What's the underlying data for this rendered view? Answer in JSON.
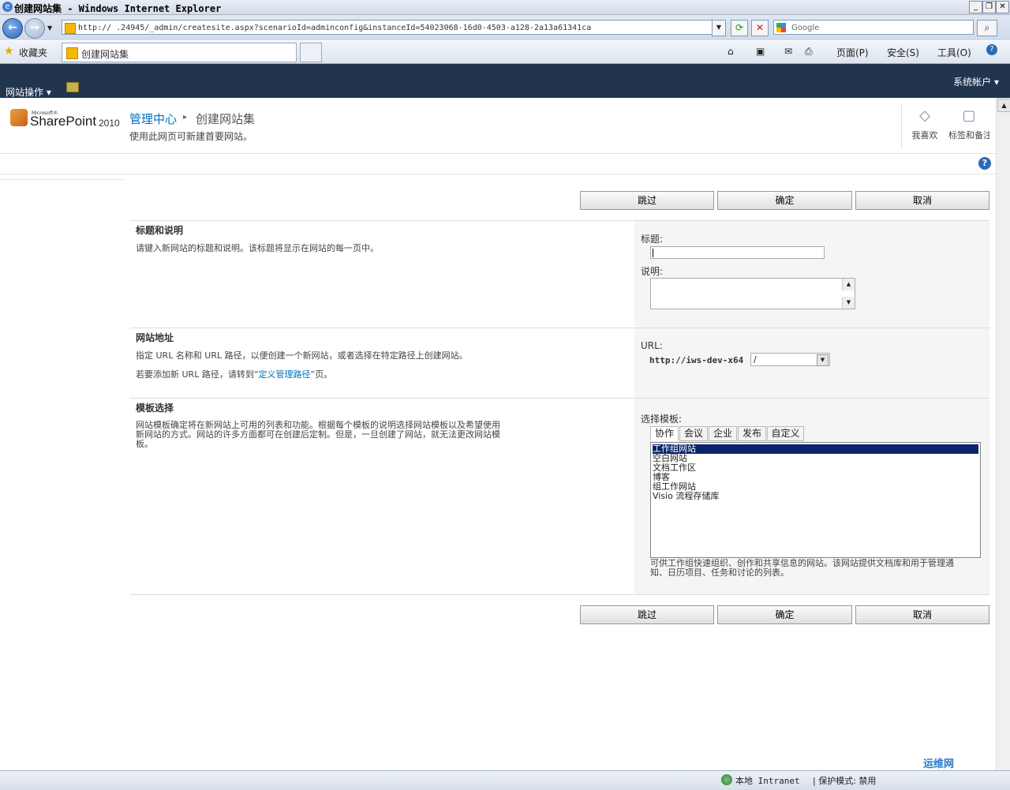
{
  "window": {
    "title": "创建网站集 - Windows Internet Explorer",
    "minimize": "_",
    "restore": "❐",
    "close": "✕"
  },
  "address": {
    "url": "http://               .24945/_admin/createsite.aspx?scenarioId=adminconfig&instanceId=54023068-16d0-4503-a128-2a13a61341ca",
    "search_placeholder": "Google"
  },
  "favorites": {
    "label": "收藏夹",
    "tab_label": "创建网站集"
  },
  "commandbar": {
    "page": "页面(P)",
    "safety": "安全(S)",
    "tools": "工具(O)"
  },
  "ribbon": {
    "site_actions": "网站操作",
    "account": "系统帐户"
  },
  "header": {
    "logo_ms": "Microsoft®",
    "logo_main": "SharePoint",
    "logo_version": "2010",
    "breadcrumb_root": "管理中心",
    "breadcrumb_sep": "▸",
    "breadcrumb_current": "创建网站集",
    "description": "使用此网页可新建首要网站。",
    "i_like_it": "我喜欢",
    "tags_notes": "标签和备注"
  },
  "buttons": {
    "skip": "跳过",
    "ok": "确定",
    "cancel": "取消"
  },
  "sections": {
    "title_desc": {
      "heading": "标题和说明",
      "text": "请键入新网站的标题和说明。该标题将显示在网站的每一页中。",
      "title_label": "标题:",
      "desc_label": "说明:"
    },
    "address": {
      "heading": "网站地址",
      "text": "指定 URL 名称和 URL 路径，以便创建一个新网站，或者选择在特定路径上创建网站。",
      "text2_prefix": "若要添加新 URL 路径，请转到“",
      "text2_link": "定义管理路径",
      "text2_suffix": "”页。",
      "url_label": "URL:",
      "url_prefix": "http://iws-dev-x64",
      "path_value": "/"
    },
    "template": {
      "heading": "模板选择",
      "text": "网站模板确定将在新网站上可用的列表和功能。根据每个模板的说明选择网站模板以及希望使用新网站的方式。网站的许多方面都可在创建后定制。但是，一旦创建了网站，就无法更改网站模板。",
      "select_label": "选择模板:",
      "tabs": [
        "协作",
        "会议",
        "企业",
        "发布",
        "自定义"
      ],
      "items": [
        "工作组网站",
        "空白网站",
        "文档工作区",
        "博客",
        "组工作网站",
        "Visio 流程存储库"
      ],
      "description": "可供工作组快速组织、创作和共享信息的网站。该网站提供文档库和用于管理通知、日历项目、任务和讨论的列表。"
    }
  },
  "status": {
    "zone": "本地 Intranet",
    "protected": "| 保护模式: 禁用"
  },
  "watermark": "运维网"
}
